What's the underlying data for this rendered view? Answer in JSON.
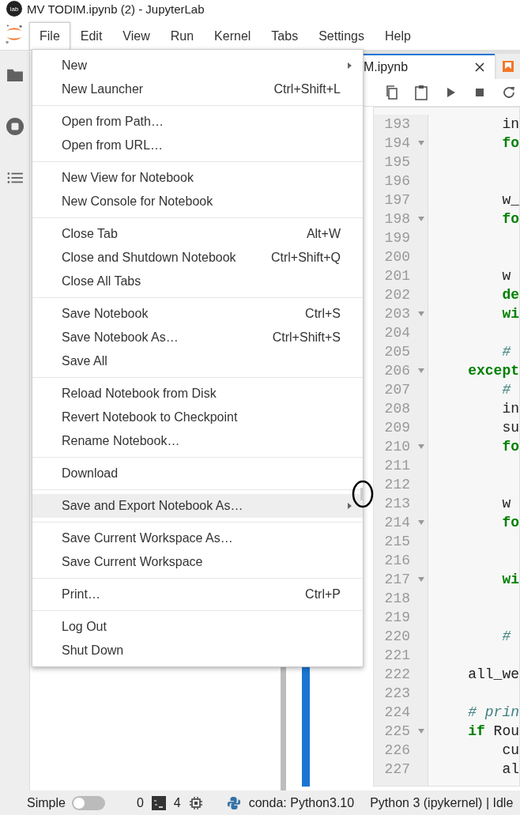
{
  "window": {
    "app_icon_text": "lab",
    "title": "MV TODIM.ipynb (2) - JupyterLab"
  },
  "menu_bar": [
    {
      "label": "File",
      "selected": true
    },
    {
      "label": "Edit",
      "selected": false
    },
    {
      "label": "View",
      "selected": false
    },
    {
      "label": "Run",
      "selected": false
    },
    {
      "label": "Kernel",
      "selected": false
    },
    {
      "label": "Tabs",
      "selected": false
    },
    {
      "label": "Settings",
      "selected": false
    },
    {
      "label": "Help",
      "selected": false
    }
  ],
  "file_menu": [
    [
      {
        "label": "New",
        "submenu": true,
        "selected": false
      },
      {
        "label": "New Launcher",
        "shortcut": "Ctrl+Shift+L",
        "submenu": false,
        "selected": false
      }
    ],
    [
      {
        "label": "Open from Path…",
        "submenu": false,
        "selected": false
      },
      {
        "label": "Open from URL…",
        "submenu": false,
        "selected": false
      }
    ],
    [
      {
        "label": "New View for Notebook",
        "submenu": false,
        "selected": false
      },
      {
        "label": "New Console for Notebook",
        "submenu": false,
        "selected": false
      }
    ],
    [
      {
        "label": "Close Tab",
        "shortcut": "Alt+W",
        "submenu": false,
        "selected": false
      },
      {
        "label": "Close and Shutdown Notebook",
        "shortcut": "Ctrl+Shift+Q",
        "submenu": false,
        "selected": false
      },
      {
        "label": "Close All Tabs",
        "submenu": false,
        "selected": false
      }
    ],
    [
      {
        "label": "Save Notebook",
        "shortcut": "Ctrl+S",
        "submenu": false,
        "selected": false
      },
      {
        "label": "Save Notebook As…",
        "shortcut": "Ctrl+Shift+S",
        "submenu": false,
        "selected": false
      },
      {
        "label": "Save All",
        "submenu": false,
        "selected": false
      }
    ],
    [
      {
        "label": "Reload Notebook from Disk",
        "submenu": false,
        "selected": false
      },
      {
        "label": "Revert Notebook to Checkpoint",
        "submenu": false,
        "selected": false
      },
      {
        "label": "Rename Notebook…",
        "submenu": false,
        "selected": false
      }
    ],
    [
      {
        "label": "Download",
        "submenu": false,
        "selected": false
      }
    ],
    [
      {
        "label": "Save and Export Notebook As…",
        "submenu": true,
        "selected": true
      }
    ],
    [
      {
        "label": "Save Current Workspace As…",
        "submenu": false,
        "selected": false
      },
      {
        "label": "Save Current Workspace",
        "submenu": false,
        "selected": false
      }
    ],
    [
      {
        "label": "Print…",
        "shortcut": "Ctrl+P",
        "submenu": false,
        "selected": false
      }
    ],
    [
      {
        "label": "Log Out",
        "submenu": false,
        "selected": false
      },
      {
        "label": "Shut Down",
        "submenu": false,
        "selected": false
      }
    ]
  ],
  "notebook_tabs": [
    {
      "label": "M.ipynb",
      "selected": true
    },
    {
      "selected": false
    }
  ],
  "code_lines": [
    {
      "number": "193",
      "foldable": false,
      "tokens": [
        {
          "kind": "plain",
          "text": "        in"
        }
      ]
    },
    {
      "number": "194",
      "foldable": true,
      "tokens": [
        {
          "kind": "keyword",
          "text": "        fo"
        }
      ]
    },
    {
      "number": "195",
      "foldable": false
    },
    {
      "number": "196",
      "foldable": false
    },
    {
      "number": "197",
      "foldable": false,
      "tokens": [
        {
          "kind": "plain",
          "text": "        w_"
        }
      ]
    },
    {
      "number": "198",
      "foldable": true,
      "tokens": [
        {
          "kind": "keyword",
          "text": "        fo"
        }
      ]
    },
    {
      "number": "199",
      "foldable": false
    },
    {
      "number": "200",
      "foldable": false
    },
    {
      "number": "201",
      "foldable": false,
      "tokens": [
        {
          "kind": "plain",
          "text": "        w"
        }
      ]
    },
    {
      "number": "202",
      "foldable": false,
      "tokens": [
        {
          "kind": "keyword",
          "text": "        de"
        }
      ]
    },
    {
      "number": "203",
      "foldable": true,
      "tokens": [
        {
          "kind": "keyword",
          "text": "        wi"
        }
      ]
    },
    {
      "number": "204",
      "foldable": false
    },
    {
      "number": "205",
      "foldable": false,
      "tokens": [
        {
          "kind": "comment",
          "text": "        #"
        }
      ]
    },
    {
      "number": "206",
      "foldable": true,
      "tokens": [
        {
          "kind": "keyword",
          "text": "    except"
        }
      ]
    },
    {
      "number": "207",
      "foldable": false,
      "tokens": [
        {
          "kind": "comment",
          "text": "        #"
        }
      ]
    },
    {
      "number": "208",
      "foldable": false,
      "tokens": [
        {
          "kind": "plain",
          "text": "        in"
        }
      ]
    },
    {
      "number": "209",
      "foldable": false,
      "tokens": [
        {
          "kind": "plain",
          "text": "        su"
        }
      ]
    },
    {
      "number": "210",
      "foldable": true,
      "tokens": [
        {
          "kind": "keyword",
          "text": "        fo"
        }
      ]
    },
    {
      "number": "211",
      "foldable": false
    },
    {
      "number": "212",
      "foldable": false
    },
    {
      "number": "213",
      "foldable": false,
      "tokens": [
        {
          "kind": "plain",
          "text": "        w"
        }
      ]
    },
    {
      "number": "214",
      "foldable": true,
      "tokens": [
        {
          "kind": "keyword",
          "text": "        fo"
        }
      ]
    },
    {
      "number": "215",
      "foldable": false
    },
    {
      "number": "216",
      "foldable": false
    },
    {
      "number": "217",
      "foldable": true,
      "tokens": [
        {
          "kind": "keyword",
          "text": "        wi"
        }
      ]
    },
    {
      "number": "218",
      "foldable": false
    },
    {
      "number": "219",
      "foldable": false
    },
    {
      "number": "220",
      "foldable": false,
      "tokens": [
        {
          "kind": "comment",
          "text": "        #"
        }
      ]
    },
    {
      "number": "221",
      "foldable": false
    },
    {
      "number": "222",
      "foldable": false,
      "tokens": [
        {
          "kind": "plain",
          "text": "    all_we"
        }
      ]
    },
    {
      "number": "223",
      "foldable": false
    },
    {
      "number": "224",
      "foldable": false,
      "tokens": [
        {
          "kind": "comment",
          "text": "    # prin"
        }
      ]
    },
    {
      "number": "225",
      "foldable": true,
      "tokens": [
        {
          "kind": "keyword",
          "text": "    if"
        },
        {
          "kind": "plain",
          "text": " Rou"
        }
      ]
    },
    {
      "number": "226",
      "foldable": false,
      "tokens": [
        {
          "kind": "plain",
          "text": "        cu"
        }
      ]
    },
    {
      "number": "227",
      "foldable": false,
      "tokens": [
        {
          "kind": "plain",
          "text": "        al"
        }
      ]
    }
  ],
  "status_bar": {
    "mode_label": "Simple",
    "simple_mode": {
      "on": false
    },
    "terminals": "0",
    "kernels": "4",
    "environment": "conda: Python3.10",
    "kernel_status": "Python 3 (ipykernel) | Idle"
  }
}
